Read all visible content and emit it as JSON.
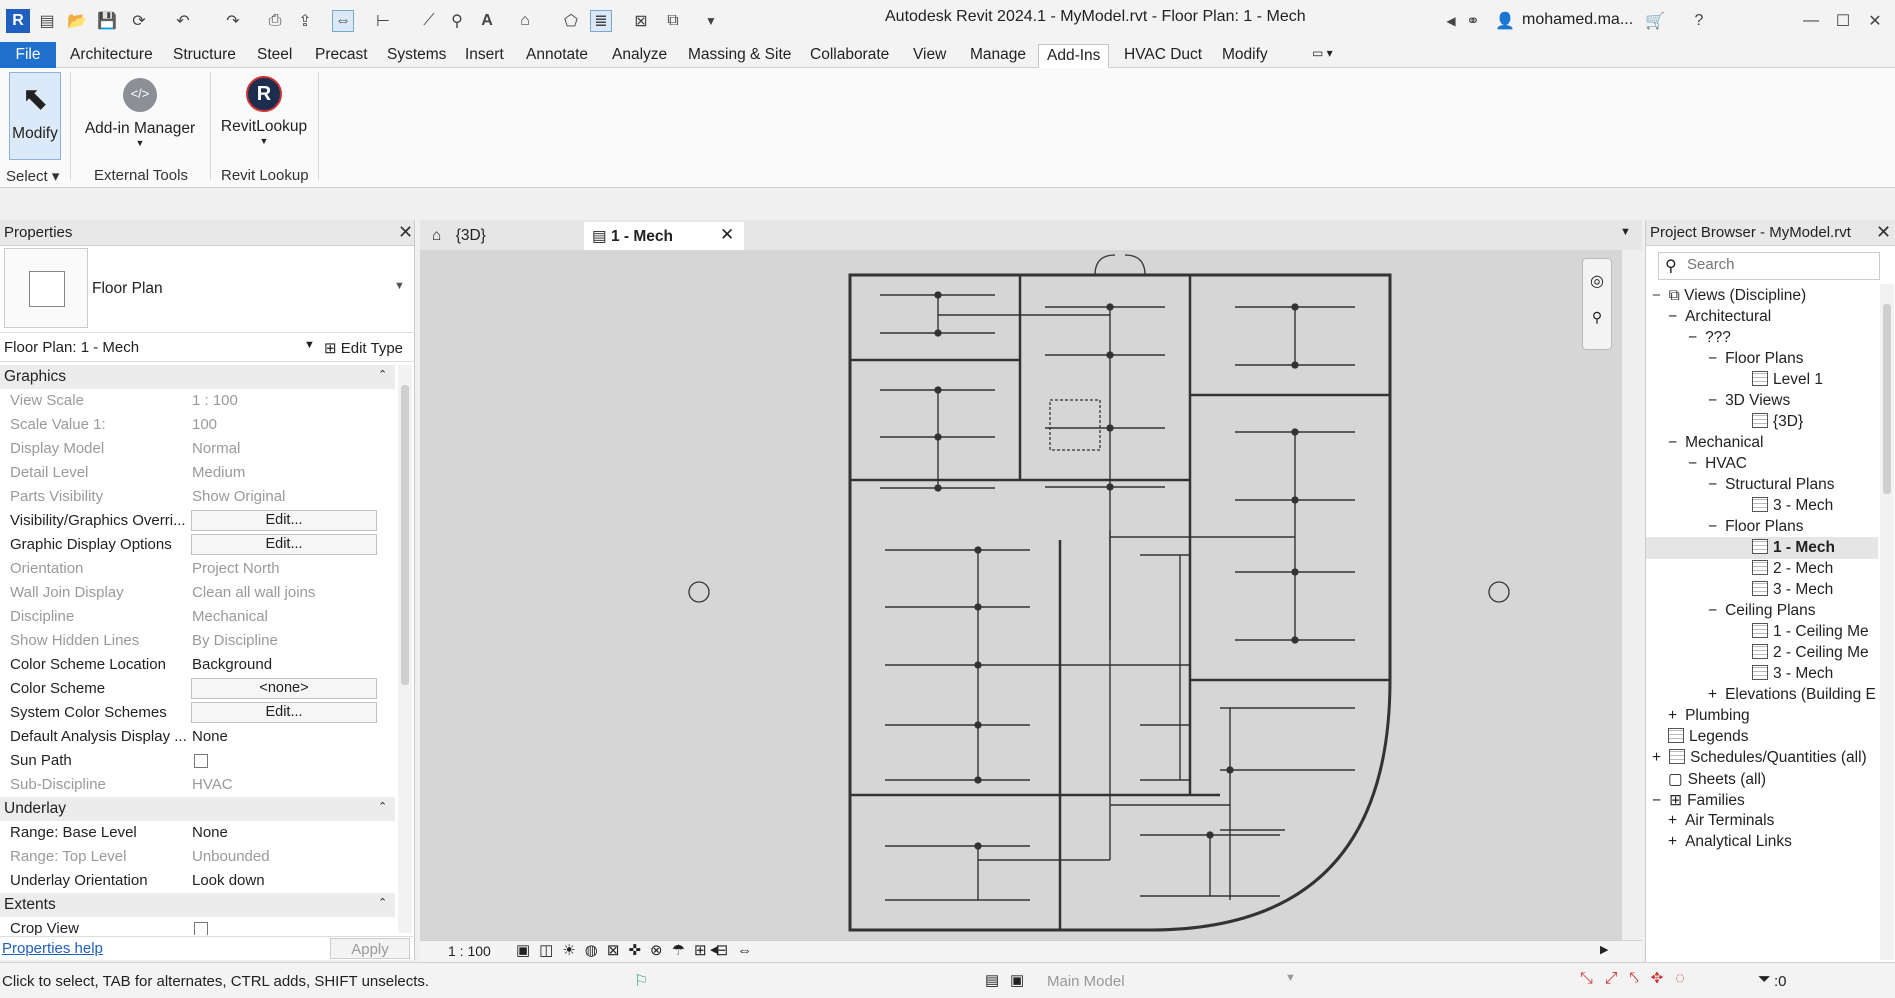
{
  "window": {
    "title": "Autodesk Revit 2024.1 - MyModel.rvt - Floor Plan: 1 - Mech",
    "user": "mohamed.ma...",
    "logo_letter": "R"
  },
  "ribbon": {
    "tabs": [
      "File",
      "Architecture",
      "Structure",
      "Steel",
      "Precast",
      "Systems",
      "Insert",
      "Annotate",
      "Analyze",
      "Massing & Site",
      "Collaborate",
      "View",
      "Manage",
      "Add-Ins",
      "HVAC Duct",
      "Modify"
    ],
    "active_tab": "Add-Ins",
    "modify_label": "Modify",
    "select_label": "Select",
    "addin_manager_label": "Add-in Manager",
    "external_tools_label": "External Tools",
    "revitlookup_label": "RevitLookup",
    "revit_lookup_panel_label": "Revit Lookup"
  },
  "properties": {
    "title": "Properties",
    "type_name": "Floor Plan",
    "instance_selector": "Floor Plan: 1 - Mech",
    "edit_type_label": "Edit Type",
    "groups": {
      "graphics": "Graphics",
      "underlay": "Underlay",
      "extents": "Extents"
    },
    "rows": [
      {
        "name": "View Scale",
        "value": "1 : 100"
      },
      {
        "name": "Scale Value    1:",
        "value": "100"
      },
      {
        "name": "Display Model",
        "value": "Normal"
      },
      {
        "name": "Detail Level",
        "value": "Medium"
      },
      {
        "name": "Parts Visibility",
        "value": "Show Original"
      },
      {
        "name": "Visibility/Graphics Overri...",
        "value": "Edit..."
      },
      {
        "name": "Graphic Display Options",
        "value": "Edit..."
      },
      {
        "name": "Orientation",
        "value": "Project North"
      },
      {
        "name": "Wall Join Display",
        "value": "Clean all wall joins"
      },
      {
        "name": "Discipline",
        "value": "Mechanical"
      },
      {
        "name": "Show Hidden Lines",
        "value": "By Discipline"
      },
      {
        "name": "Color Scheme Location",
        "value": "Background"
      },
      {
        "name": "Color Scheme",
        "value": "<none>"
      },
      {
        "name": "System Color Schemes",
        "value": "Edit..."
      },
      {
        "name": "Default Analysis Display ...",
        "value": "None"
      },
      {
        "name": "Sun Path",
        "value": ""
      },
      {
        "name": "Sub-Discipline",
        "value": "HVAC"
      }
    ],
    "underlay_rows": [
      {
        "name": "Range: Base Level",
        "value": "None"
      },
      {
        "name": "Range: Top Level",
        "value": "Unbounded"
      },
      {
        "name": "Underlay Orientation",
        "value": "Look down"
      }
    ],
    "extents_rows": [
      {
        "name": "Crop View",
        "value": ""
      }
    ],
    "help_link": "Properties help",
    "apply_label": "Apply"
  },
  "views": {
    "tabs": [
      "{3D}",
      "1 - Mech"
    ],
    "active": "1 - Mech",
    "scale": "1 : 100"
  },
  "browser": {
    "title": "Project Browser - MyModel.rvt",
    "search_placeholder": "Search",
    "nodes": [
      {
        "label": "Views (Discipline)",
        "sign": "−"
      },
      {
        "label": "Architectural",
        "sign": "−"
      },
      {
        "label": "???",
        "sign": "−"
      },
      {
        "label": "Floor Plans",
        "sign": "−"
      },
      {
        "label": "Level 1",
        "sign": ""
      },
      {
        "label": "3D Views",
        "sign": "−"
      },
      {
        "label": "{3D}",
        "sign": ""
      },
      {
        "label": "Mechanical",
        "sign": "−"
      },
      {
        "label": "HVAC",
        "sign": "−"
      },
      {
        "label": "Structural Plans",
        "sign": "−"
      },
      {
        "label": "3 - Mech",
        "sign": ""
      },
      {
        "label": "Floor Plans",
        "sign": "−"
      },
      {
        "label": "1 - Mech",
        "sign": ""
      },
      {
        "label": "2 - Mech",
        "sign": ""
      },
      {
        "label": "3 - Mech",
        "sign": ""
      },
      {
        "label": "Ceiling Plans",
        "sign": "−"
      },
      {
        "label": "1 - Ceiling Me",
        "sign": ""
      },
      {
        "label": "2 - Ceiling Me",
        "sign": ""
      },
      {
        "label": "3 - Mech",
        "sign": ""
      },
      {
        "label": "Elevations (Building E",
        "sign": "+"
      },
      {
        "label": "Plumbing",
        "sign": "+"
      },
      {
        "label": "Legends",
        "sign": ""
      },
      {
        "label": "Schedules/Quantities (all)",
        "sign": "+"
      },
      {
        "label": "Sheets (all)",
        "sign": ""
      },
      {
        "label": "Families",
        "sign": "−"
      },
      {
        "label": "Air Terminals",
        "sign": "+"
      },
      {
        "label": "Analytical Links",
        "sign": "+"
      }
    ]
  },
  "status": {
    "hint": "Click to select, TAB for alternates, CTRL adds, SHIFT unselects.",
    "model": "Main Model",
    "filter_count": ":0"
  },
  "colors": {
    "accent": "#1f6fcc",
    "canvas": "#d6d6d6"
  }
}
